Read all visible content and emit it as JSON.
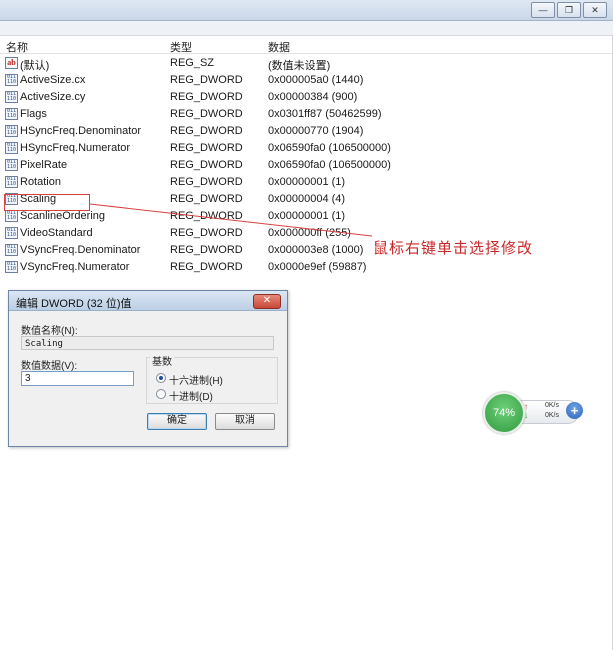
{
  "window": {
    "buttons": [
      {
        "glyph": "—",
        "icon": "minimize-icon"
      },
      {
        "glyph": "❐",
        "icon": "restore-icon"
      },
      {
        "glyph": "✕",
        "icon": "close-icon"
      }
    ]
  },
  "columns": {
    "name": "名称",
    "type": "类型",
    "data": "数据"
  },
  "rows": [
    {
      "icon": "string-value-icon",
      "name": "(默认)",
      "type": "REG_SZ",
      "data": "(数值未设置)"
    },
    {
      "icon": "binary-value-icon",
      "name": "ActiveSize.cx",
      "type": "REG_DWORD",
      "data": "0x000005a0 (1440)"
    },
    {
      "icon": "binary-value-icon",
      "name": "ActiveSize.cy",
      "type": "REG_DWORD",
      "data": "0x00000384 (900)"
    },
    {
      "icon": "binary-value-icon",
      "name": "Flags",
      "type": "REG_DWORD",
      "data": "0x0301ff87 (50462599)"
    },
    {
      "icon": "binary-value-icon",
      "name": "HSyncFreq.Denominator",
      "type": "REG_DWORD",
      "data": "0x00000770 (1904)"
    },
    {
      "icon": "binary-value-icon",
      "name": "HSyncFreq.Numerator",
      "type": "REG_DWORD",
      "data": "0x06590fa0 (106500000)"
    },
    {
      "icon": "binary-value-icon",
      "name": "PixelRate",
      "type": "REG_DWORD",
      "data": "0x06590fa0 (106500000)"
    },
    {
      "icon": "binary-value-icon",
      "name": "Rotation",
      "type": "REG_DWORD",
      "data": "0x00000001 (1)"
    },
    {
      "icon": "binary-value-icon",
      "name": "Scaling",
      "type": "REG_DWORD",
      "data": "0x00000004 (4)"
    },
    {
      "icon": "binary-value-icon",
      "name": "ScanlineOrdering",
      "type": "REG_DWORD",
      "data": "0x00000001 (1)"
    },
    {
      "icon": "binary-value-icon",
      "name": "VideoStandard",
      "type": "REG_DWORD",
      "data": "0x000000ff (255)"
    },
    {
      "icon": "binary-value-icon",
      "name": "VSyncFreq.Denominator",
      "type": "REG_DWORD",
      "data": "0x000003e8 (1000)"
    },
    {
      "icon": "binary-value-icon",
      "name": "VSyncFreq.Numerator",
      "type": "REG_DWORD",
      "data": "0x0000e9ef (59887)"
    }
  ],
  "annotation": {
    "text": "鼠标右键单击选择修改",
    "color": "#c8282a"
  },
  "dialog": {
    "title": "编辑 DWORD (32 位)值",
    "close_glyph": "✕",
    "name_label": "数值名称(N):",
    "name_value": "Scaling",
    "data_label": "数值数据(V):",
    "data_value": "3",
    "radix_label": "基数",
    "radix_options": [
      {
        "label": "十六进制(H)",
        "selected": true
      },
      {
        "label": "十进制(D)",
        "selected": false
      }
    ],
    "ok_label": "确定",
    "cancel_label": "取消"
  },
  "net_widget": {
    "percent": "74%",
    "upload": "0K/s",
    "download": "0K/s",
    "up_glyph": "↑",
    "down_glyph": "↓",
    "plus_glyph": "+"
  }
}
